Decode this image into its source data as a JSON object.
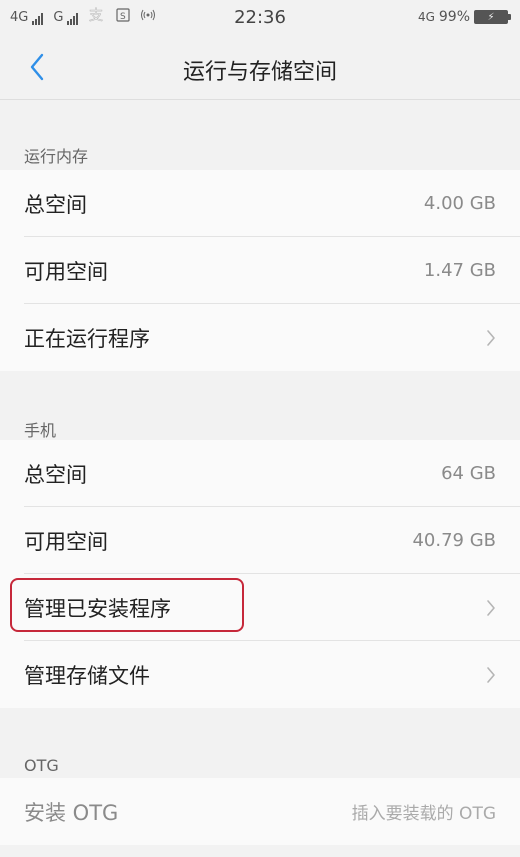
{
  "status_bar": {
    "net1": "4G",
    "net2": "G",
    "time": "22:36",
    "net_right": "4G",
    "battery": "99%"
  },
  "nav": {
    "title": "运行与存储空间"
  },
  "sections": {
    "ram": {
      "header": "运行内存",
      "total_label": "总空间",
      "total_value": "4.00 GB",
      "available_label": "可用空间",
      "available_value": "1.47 GB",
      "running_label": "正在运行程序"
    },
    "phone": {
      "header": "手机",
      "total_label": "总空间",
      "total_value": "64 GB",
      "available_label": "可用空间",
      "available_value": "40.79 GB",
      "manage_apps_label": "管理已安装程序",
      "manage_files_label": "管理存储文件"
    },
    "otg": {
      "header": "OTG",
      "install_label": "安装 OTG",
      "install_hint": "插入要装载的 OTG"
    }
  }
}
